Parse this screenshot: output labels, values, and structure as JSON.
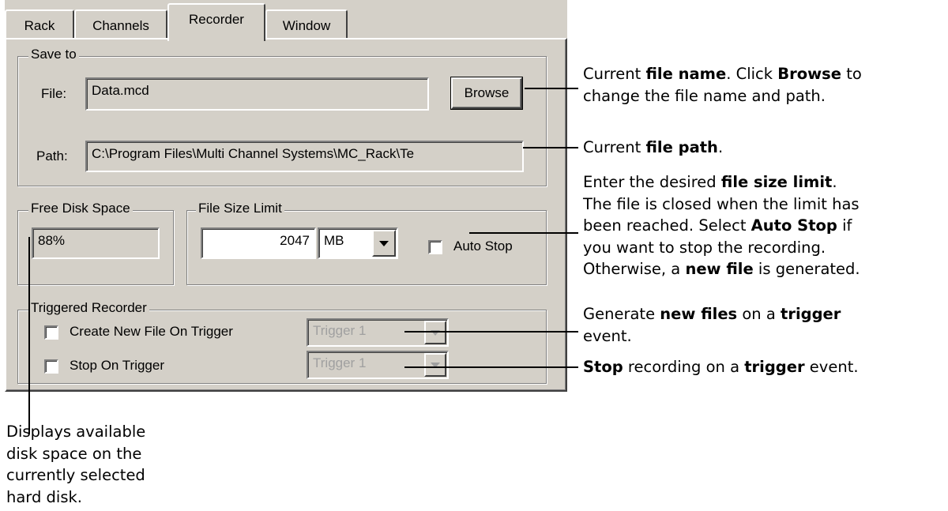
{
  "tabs": [
    "Rack",
    "Channels",
    "Recorder",
    "Window"
  ],
  "active_tab": "Recorder",
  "save_to": {
    "legend": "Save to",
    "file_label": "File:",
    "file_value": "Data.mcd",
    "browse_label": "Browse",
    "path_label": "Path:",
    "path_value": "C:\\Program Files\\Multi Channel Systems\\MC_Rack\\Te"
  },
  "free_disk": {
    "legend": "Free Disk Space",
    "value": "88%"
  },
  "file_size_limit": {
    "legend": "File Size Limit",
    "value": "2047",
    "unit": "MB",
    "auto_stop_label": "Auto Stop",
    "auto_stop_checked": false
  },
  "triggered_recorder": {
    "legend": "Triggered Recorder",
    "create_new_label": "Create New File On Trigger",
    "create_new_checked": false,
    "create_trigger_value": "Trigger 1",
    "stop_label": "Stop On Trigger",
    "stop_checked": false,
    "stop_trigger_value": "Trigger 1"
  },
  "annotations": {
    "file_name": {
      "pre": "Current ",
      "b1": "file name",
      "mid": ". Click ",
      "b2": "Browse",
      "post": " to",
      "line2": "change the file name and path."
    },
    "file_path": {
      "pre": "Current ",
      "b1": "file path",
      "post": "."
    },
    "size_limit": {
      "l1_pre": "Enter the desired ",
      "l1_b": "file size limit",
      "l1_post": ".",
      "l2": "The file is closed when the limit has",
      "l3_pre": "been reached. Select ",
      "l3_b": "Auto Stop",
      "l3_post": " if",
      "l4": "you want to stop the recording.",
      "l5_pre": "Otherwise, a ",
      "l5_b": "new file",
      "l5_post": " is generated."
    },
    "new_files": {
      "pre": "Generate ",
      "b1": "new files",
      "mid": " on a ",
      "b2": "trigger",
      "line2": "event."
    },
    "stop": {
      "b1": "Stop",
      "mid": " recording on a ",
      "b2": "trigger",
      "post": " event."
    },
    "disk_space": [
      "Displays available",
      "disk space on the",
      "currently selected",
      "hard disk."
    ]
  }
}
